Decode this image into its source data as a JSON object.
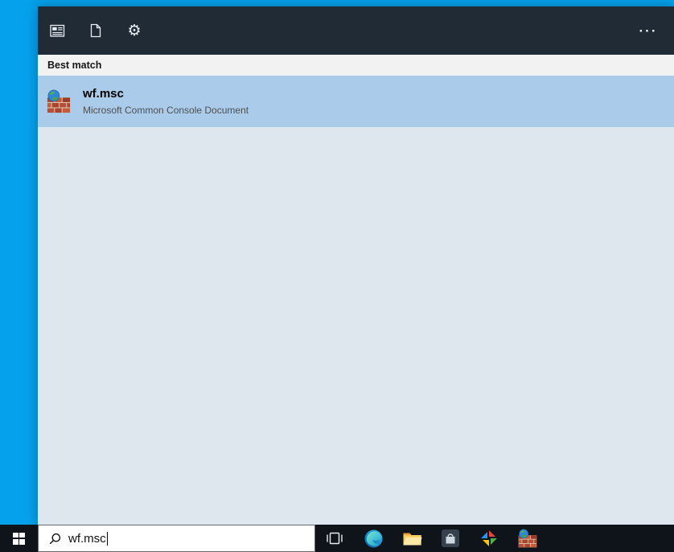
{
  "colors": {
    "desktop_blue": "#06a1ec",
    "panel_header_bg": "#212b36",
    "section_bg": "#f2f2f2",
    "selected_result_bg": "#aacbe9",
    "panel_body_bg": "#dfe7ee",
    "taskbar_bg": "#0f141a",
    "search_box_bg": "#ffffff"
  },
  "search_panel": {
    "header": {
      "filter_icons": [
        "apps-filter-icon",
        "documents-filter-icon",
        "settings-filter-icon"
      ],
      "more_label": "···"
    },
    "section_title": "Best match",
    "best_match": {
      "icon": "windows-firewall-icon",
      "title": "wf.msc",
      "subtitle": "Microsoft Common Console Document"
    }
  },
  "taskbar": {
    "start_icon": "windows-start-icon",
    "search_box": {
      "icon": "search-icon",
      "value": "wf.msc"
    },
    "button_icons": [
      "task-view-icon",
      "edge-icon",
      "file-explorer-icon",
      "pinned-app-icon-1",
      "pinned-app-icon-2",
      "windows-firewall-icon"
    ]
  }
}
